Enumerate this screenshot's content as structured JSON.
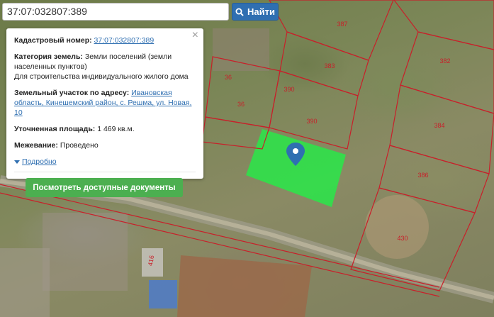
{
  "search": {
    "value": "37:07:032807:389",
    "button_label": "Найти"
  },
  "popup": {
    "cadastral_label": "Кадастровый номер:",
    "cadastral_value": "37:07:032807:389",
    "category_label": "Категория земель:",
    "category_value": "Земли поселений (земли населенных пунктов)",
    "category_purpose": "Для строительства индивидуального жилого дома",
    "address_label": "Земельный участок по адресу:",
    "address_value": "Ивановская область, Кинешемский район, с. Решма, ул. Новая, 10",
    "area_label": "Уточненная площадь:",
    "area_value": "1 469 кв.м.",
    "survey_label": "Межевание:",
    "survey_value": "Проведено",
    "details_link": "Подробно",
    "documents_button": "Посмотреть доступные документы"
  },
  "parcels": [
    {
      "number": "387"
    },
    {
      "number": "382"
    },
    {
      "number": "383"
    },
    {
      "number": "384"
    },
    {
      "number": "386"
    },
    {
      "number": "390"
    },
    {
      "number": "390"
    },
    {
      "number": "36"
    },
    {
      "number": "36"
    },
    {
      "number": "430"
    },
    {
      "number": "416"
    }
  ],
  "colors": {
    "parcel_border": "#c8202a",
    "selected_parcel": "#2fe24a",
    "pin": "#2f6fb1",
    "button_blue": "#2f6fb1",
    "button_green": "#4caf50"
  },
  "icons": {
    "search": "search-icon",
    "close": "close-icon",
    "pin": "map-pin-icon",
    "expand": "triangle-down-icon"
  }
}
